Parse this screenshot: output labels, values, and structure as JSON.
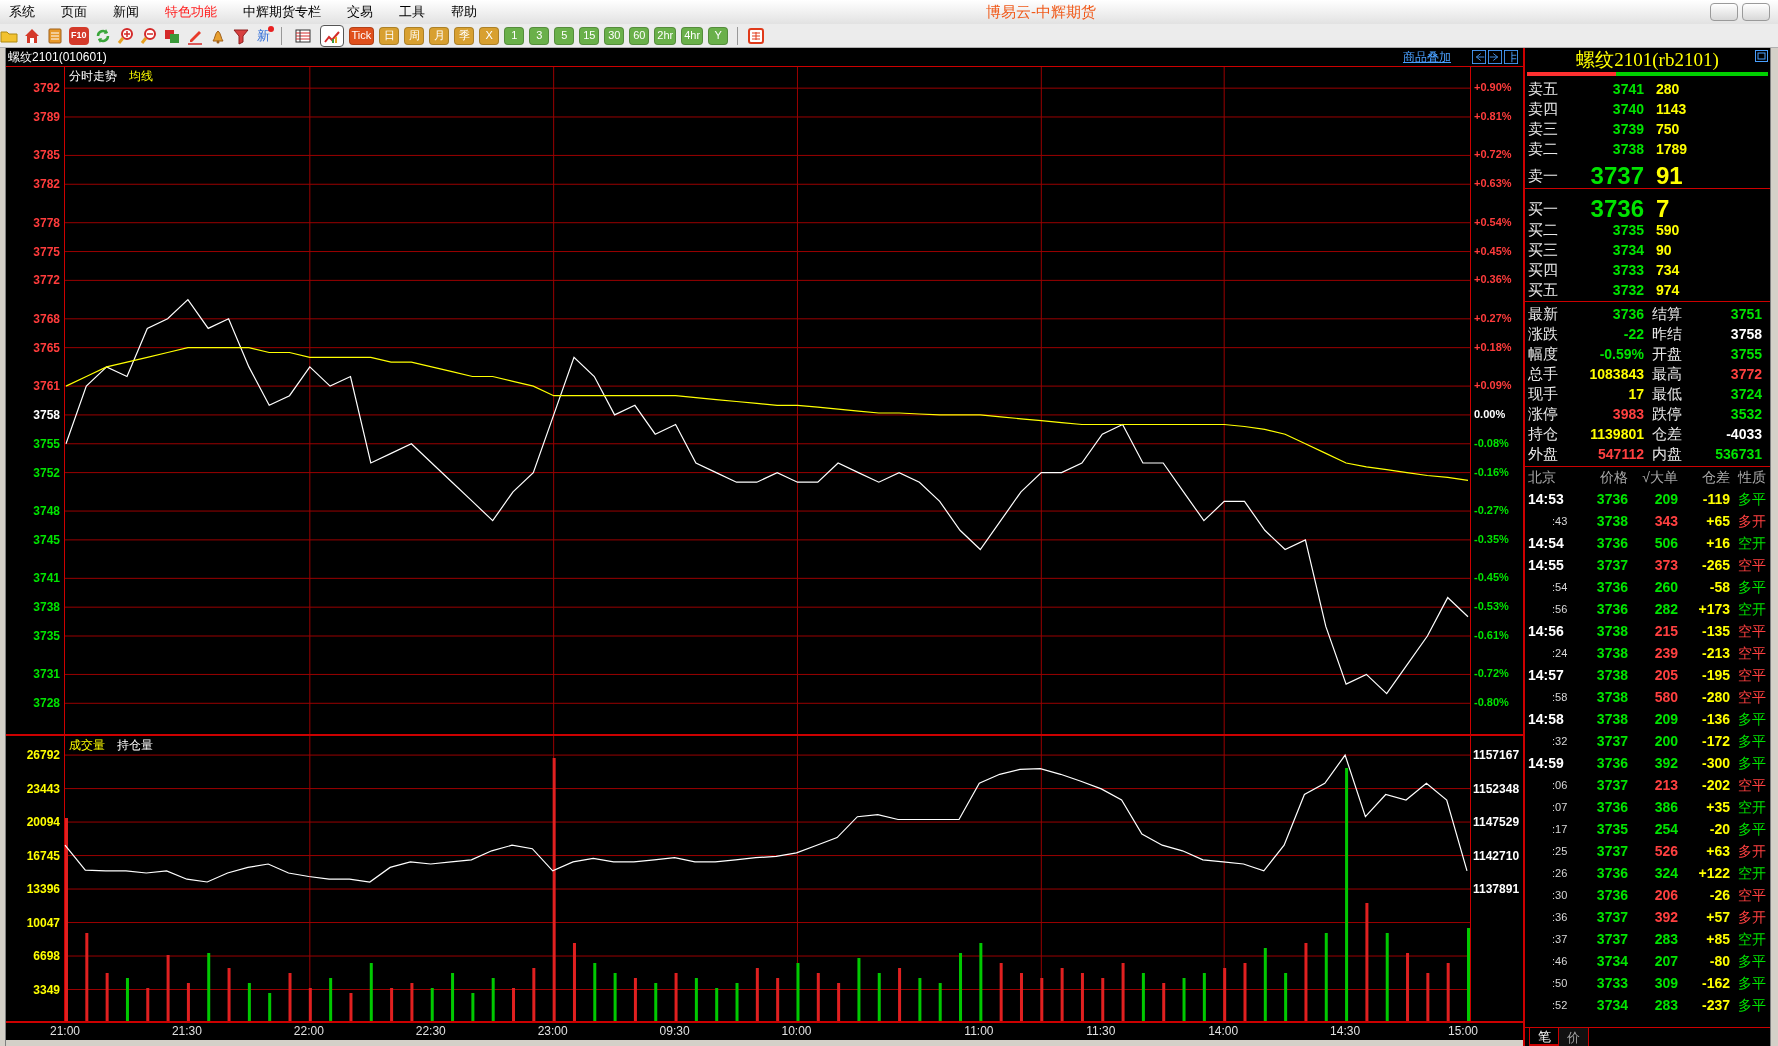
{
  "menu": [
    {
      "label": "系统",
      "highlighted": false
    },
    {
      "label": "页面",
      "highlighted": false
    },
    {
      "label": "新闻",
      "highlighted": false
    },
    {
      "label": "特色功能",
      "highlighted": true
    },
    {
      "label": "中辉期货专栏",
      "highlighted": false
    },
    {
      "label": "交易",
      "highlighted": false
    },
    {
      "label": "工具",
      "highlighted": false
    },
    {
      "label": "帮助",
      "highlighted": false
    }
  ],
  "title": "博易云-中辉期货",
  "toolbar": {
    "f10_label": "F10",
    "news_label": "新",
    "view_buttons": [
      {
        "selected": false
      },
      {
        "selected": true
      }
    ],
    "period_buttons": [
      {
        "label": "Tick",
        "kind": "tick"
      },
      {
        "label": "日",
        "kind": "day"
      },
      {
        "label": "周",
        "kind": "day"
      },
      {
        "label": "月",
        "kind": "day"
      },
      {
        "label": "季",
        "kind": "day"
      },
      {
        "label": "X",
        "kind": "day"
      },
      {
        "label": "1",
        "kind": "minute"
      },
      {
        "label": "3",
        "kind": "minute"
      },
      {
        "label": "5",
        "kind": "minute"
      },
      {
        "label": "15",
        "kind": "minute"
      },
      {
        "label": "30",
        "kind": "minute"
      },
      {
        "label": "60",
        "kind": "minute"
      },
      {
        "label": "2hr",
        "kind": "minute"
      },
      {
        "label": "4hr",
        "kind": "minute"
      },
      {
        "label": "Y",
        "kind": "minute"
      }
    ]
  },
  "chart_header": {
    "symbol": "螺纹2101(010601)",
    "overlay_link": "商品叠加"
  },
  "price_panel": {
    "pct_labels": [
      {
        "label": "+0.90%",
        "color": "#ff3c3c"
      },
      {
        "label": "+0.81%",
        "color": "#ff3c3c"
      },
      {
        "label": "+0.72%",
        "color": "#ff3c3c"
      },
      {
        "label": "+0.63%",
        "color": "#ff3c3c"
      },
      {
        "label": "+0.54%",
        "color": "#ff3c3c"
      },
      {
        "label": "+0.45%",
        "color": "#ff3c3c"
      },
      {
        "label": "+0.36%",
        "color": "#ff3c3c"
      },
      {
        "label": "+0.27%",
        "color": "#ff3c3c"
      },
      {
        "label": "+0.18%",
        "color": "#ff3c3c"
      },
      {
        "label": "+0.09%",
        "color": "#ff3c3c"
      },
      {
        "label": "0.00%",
        "color": "#ffffff"
      },
      {
        "label": "-0.08%",
        "color": "#00e400"
      },
      {
        "label": "-0.16%",
        "color": "#00e400"
      },
      {
        "label": "-0.27%",
        "color": "#00e400"
      },
      {
        "label": "-0.35%",
        "color": "#00e400"
      },
      {
        "label": "-0.45%",
        "color": "#00e400"
      },
      {
        "label": "-0.53%",
        "color": "#00e400"
      },
      {
        "label": "-0.61%",
        "color": "#00e400"
      },
      {
        "label": "-0.72%",
        "color": "#00e400"
      },
      {
        "label": "-0.80%",
        "color": "#00e400"
      }
    ],
    "chart_data": {
      "type": "line",
      "grid": true,
      "ylim": [
        3724.7,
        3794.2
      ],
      "yticks": [
        {
          "value": 3792,
          "label": "3792"
        },
        {
          "value": 3789,
          "label": "3789"
        },
        {
          "value": 3785,
          "label": "3785"
        },
        {
          "value": 3782,
          "label": "3782"
        },
        {
          "value": 3778,
          "label": "3778"
        },
        {
          "value": 3775,
          "label": "3775"
        },
        {
          "value": 3772,
          "label": "3772"
        },
        {
          "value": 3768,
          "label": "3768"
        },
        {
          "value": 3765,
          "label": "3765"
        },
        {
          "value": 3761,
          "label": "3761"
        },
        {
          "value": 3758,
          "label": "3758"
        },
        {
          "value": 3755,
          "label": "3755"
        },
        {
          "value": 3752,
          "label": "3752"
        },
        {
          "value": 3748,
          "label": "3748"
        },
        {
          "value": 3745,
          "label": "3745"
        },
        {
          "value": 3741,
          "label": "3741"
        },
        {
          "value": 3738,
          "label": "3738"
        },
        {
          "value": 3735,
          "label": "3735"
        },
        {
          "value": 3731,
          "label": "3731"
        },
        {
          "value": 3728,
          "label": "3728"
        }
      ],
      "series": [
        {
          "name": "分时走势",
          "color": "#ffffff",
          "values": [
            3755,
            3761,
            3763,
            3762,
            3767,
            3768,
            3770,
            3767,
            3768,
            3763,
            3759,
            3760,
            3763,
            3761,
            3762,
            3753,
            3754,
            3755,
            3753,
            3751,
            3749,
            3747,
            3750,
            3752,
            3758,
            3764,
            3762,
            3758,
            3759,
            3756,
            3757,
            3753,
            3752,
            3751,
            3751,
            3752,
            3751,
            3751,
            3753,
            3752,
            3751,
            3752,
            3751,
            3749,
            3746,
            3744,
            3747,
            3750,
            3752,
            3752,
            3753,
            3756,
            3757,
            3753,
            3753,
            3750,
            3747,
            3749,
            3749,
            3746,
            3744,
            3745,
            3736,
            3730,
            3731,
            3729,
            3732,
            3735,
            3739,
            3737
          ]
        },
        {
          "name": "均线",
          "color": "#ffff00",
          "values": [
            3761,
            3762,
            3763,
            3763.5,
            3764,
            3764.5,
            3765,
            3765,
            3765,
            3765,
            3764.5,
            3764.5,
            3764,
            3764,
            3764,
            3764,
            3763.5,
            3763.5,
            3763,
            3762.5,
            3762,
            3762,
            3761.5,
            3761,
            3760,
            3760,
            3760,
            3760,
            3760,
            3760,
            3760,
            3759.8,
            3759.6,
            3759.4,
            3759.2,
            3759,
            3759,
            3758.8,
            3758.6,
            3758.4,
            3758.2,
            3758.2,
            3758.1,
            3758,
            3758,
            3758,
            3757.8,
            3757.6,
            3757.4,
            3757.2,
            3757,
            3757,
            3757,
            3757,
            3757,
            3757,
            3757,
            3757,
            3756.8,
            3756.5,
            3756,
            3755,
            3754,
            3753,
            3752.6,
            3752.3,
            3752,
            3751.7,
            3751.5,
            3751.2
          ]
        }
      ]
    }
  },
  "volume_panel": {
    "volume": {
      "chart_data": {
        "type": "bar",
        "grid": true,
        "ylim": [
          0,
          28700
        ],
        "yticks": [
          {
            "value": 26792,
            "label": "26792"
          },
          {
            "value": 23443,
            "label": "23443"
          },
          {
            "value": 20094,
            "label": "20094"
          },
          {
            "value": 16745,
            "label": "16745"
          },
          {
            "value": 13396,
            "label": "13396"
          },
          {
            "value": 10047,
            "label": "10047"
          },
          {
            "value": 6698,
            "label": "6698"
          },
          {
            "value": 3349,
            "label": "3349"
          }
        ],
        "categories": [
          "21:00",
          null,
          null,
          null,
          null,
          null,
          "21:30",
          null,
          null,
          null,
          null,
          null,
          "22:00",
          null,
          null,
          null,
          null,
          null,
          "22:30",
          null,
          null,
          null,
          null,
          null,
          "23:00",
          null,
          null,
          null,
          null,
          null,
          "09:30",
          null,
          null,
          null,
          null,
          null,
          "10:00",
          null,
          null,
          null,
          null,
          null,
          null,
          null,
          null,
          "11:00",
          null,
          null,
          null,
          null,
          null,
          "11:30",
          null,
          null,
          null,
          null,
          null,
          "14:00",
          null,
          null,
          null,
          null,
          null,
          "14:30",
          null,
          null,
          null,
          null,
          null,
          "15:00"
        ],
        "series": [
          {
            "name": "成交量",
            "values": [
              20500,
              9000,
              5000,
              4500,
              3500,
              6800,
              4000,
              7000,
              5500,
              4000,
              3000,
              5000,
              3500,
              4500,
              3000,
              6000,
              3500,
              4000,
              3500,
              5000,
              3000,
              4500,
              3500,
              5500,
              26500,
              8000,
              6000,
              5000,
              4500,
              4000,
              5000,
              4500,
              3500,
              4000,
              5500,
              4500,
              6000,
              5000,
              4000,
              6500,
              5000,
              5500,
              4500,
              4000,
              7000,
              8000,
              6000,
              5000,
              4500,
              5500,
              5000,
              4500,
              6000,
              5000,
              4000,
              4500,
              5000,
              5500,
              6000,
              7500,
              5000,
              8000,
              9000,
              25500,
              12000,
              9000,
              7000,
              5000,
              6000,
              9500
            ]
          }
        ]
      }
    },
    "open_interest": {
      "chart_data": {
        "type": "line",
        "ylim": [
          1137891,
          1157167
        ],
        "yticks": [
          {
            "value": 1157167,
            "label": "1157167"
          },
          {
            "value": 1152348,
            "label": "1152348"
          },
          {
            "value": 1147529,
            "label": "1147529"
          },
          {
            "value": 1142710,
            "label": "1142710"
          },
          {
            "value": 1137891,
            "label": "1137891"
          }
        ],
        "series": [
          {
            "name": "持仓量",
            "color": "#ffffff",
            "values": [
              1144200,
              1140600,
              1140500,
              1140500,
              1140200,
              1140500,
              1139300,
              1138900,
              1140200,
              1141000,
              1141500,
              1140200,
              1139700,
              1139300,
              1139300,
              1138900,
              1141000,
              1141800,
              1141500,
              1141800,
              1142100,
              1143400,
              1144200,
              1143700,
              1140500,
              1141800,
              1142300,
              1141800,
              1141800,
              1142100,
              1142400,
              1141800,
              1141800,
              1142100,
              1142400,
              1142600,
              1143100,
              1144200,
              1145300,
              1148300,
              1148600,
              1147900,
              1147900,
              1147900,
              1147900,
              1153100,
              1154400,
              1155100,
              1155200,
              1154400,
              1153400,
              1152300,
              1150700,
              1145800,
              1144200,
              1143400,
              1142100,
              1141800,
              1141500,
              1140500,
              1144200,
              1151500,
              1153100,
              1157167,
              1148300,
              1151500,
              1150700,
              1153100,
              1150700,
              1140500
            ]
          }
        ]
      }
    }
  },
  "quote": {
    "title": "螺纹2101(rb2101)",
    "ratio_bar": {
      "level": 0.37
    },
    "asks": [
      {
        "label": "卖五",
        "price": "3741",
        "volume": "280",
        "best": false
      },
      {
        "label": "卖四",
        "price": "3740",
        "volume": "1143",
        "best": false
      },
      {
        "label": "卖三",
        "price": "3739",
        "volume": "750",
        "best": false
      },
      {
        "label": "卖二",
        "price": "3738",
        "volume": "1789",
        "best": false
      },
      {
        "label": "卖一",
        "price": "3737",
        "volume": "91",
        "best": true
      }
    ],
    "bids": [
      {
        "label": "买一",
        "price": "3736",
        "volume": "7",
        "best": true
      },
      {
        "label": "买二",
        "price": "3735",
        "volume": "590",
        "best": false
      },
      {
        "label": "买三",
        "price": "3734",
        "volume": "90",
        "best": false
      },
      {
        "label": "买四",
        "price": "3733",
        "volume": "734",
        "best": false
      },
      {
        "label": "买五",
        "price": "3732",
        "volume": "974",
        "best": false
      }
    ],
    "fields": [
      {
        "label": "最新",
        "value": "3736",
        "color": "#00e400"
      },
      {
        "label": "结算",
        "value": "3751",
        "color": "#00e400"
      },
      {
        "label": "涨跌",
        "value": "-22",
        "color": "#00e400"
      },
      {
        "label": "昨结",
        "value": "3758",
        "color": "#ffffff"
      },
      {
        "label": "幅度",
        "value": "-0.59%",
        "color": "#00e400"
      },
      {
        "label": "开盘",
        "value": "3755",
        "color": "#00e400"
      },
      {
        "label": "总手",
        "value": "1083843",
        "color": "#ffff00"
      },
      {
        "label": "最高",
        "value": "3772",
        "color": "#ff4040"
      },
      {
        "label": "现手",
        "value": "17",
        "color": "#ffff00"
      },
      {
        "label": "最低",
        "value": "3724",
        "color": "#00e400"
      },
      {
        "label": "涨停",
        "value": "3983",
        "color": "#ff4040"
      },
      {
        "label": "跌停",
        "value": "3532",
        "color": "#00e400"
      },
      {
        "label": "持仓",
        "value": "1139801",
        "color": "#ffff00"
      },
      {
        "label": "仓差",
        "value": "-4033",
        "color": "#ffffff"
      },
      {
        "label": "外盘",
        "value": "547112",
        "color": "#ff4040"
      },
      {
        "label": "内盘",
        "value": "536731",
        "color": "#00e400"
      }
    ]
  },
  "ticks": {
    "columns": [
      "北京",
      "价格",
      "√大单",
      "仓差",
      "性质"
    ],
    "rows": [
      {
        "time": "14:53",
        "kind": "minute",
        "price": "3736",
        "volume": "209",
        "oi_change": "-119",
        "nature": "多平",
        "color": "#00e400"
      },
      {
        "time": ":43",
        "kind": "second",
        "price": "3738",
        "volume": "343",
        "oi_change": "+65",
        "nature": "多开",
        "color": "#ff4040"
      },
      {
        "time": "14:54",
        "kind": "minute",
        "price": "3736",
        "volume": "506",
        "oi_change": "+16",
        "nature": "空开",
        "color": "#00e400"
      },
      {
        "time": "14:55",
        "kind": "minute",
        "price": "3737",
        "volume": "373",
        "oi_change": "-265",
        "nature": "空平",
        "color": "#ff4040"
      },
      {
        "time": ":54",
        "kind": "second",
        "price": "3736",
        "volume": "260",
        "oi_change": "-58",
        "nature": "多平",
        "color": "#00e400"
      },
      {
        "time": ":56",
        "kind": "second",
        "price": "3736",
        "volume": "282",
        "oi_change": "+173",
        "nature": "空开",
        "color": "#00e400"
      },
      {
        "time": "14:56",
        "kind": "minute",
        "price": "3738",
        "volume": "215",
        "oi_change": "-135",
        "nature": "空平",
        "color": "#ff4040"
      },
      {
        "time": ":24",
        "kind": "second",
        "price": "3738",
        "volume": "239",
        "oi_change": "-213",
        "nature": "空平",
        "color": "#ff4040"
      },
      {
        "time": "14:57",
        "kind": "minute",
        "price": "3738",
        "volume": "205",
        "oi_change": "-195",
        "nature": "空平",
        "color": "#ff4040"
      },
      {
        "time": ":58",
        "kind": "second",
        "price": "3738",
        "volume": "580",
        "oi_change": "-280",
        "nature": "空平",
        "color": "#ff4040"
      },
      {
        "time": "14:58",
        "kind": "minute",
        "price": "3738",
        "volume": "209",
        "oi_change": "-136",
        "nature": "多平",
        "color": "#00e400"
      },
      {
        "time": ":32",
        "kind": "second",
        "price": "3737",
        "volume": "200",
        "oi_change": "-172",
        "nature": "多平",
        "color": "#00e400"
      },
      {
        "time": "14:59",
        "kind": "minute",
        "price": "3736",
        "volume": "392",
        "oi_change": "-300",
        "nature": "多平",
        "color": "#00e400"
      },
      {
        "time": ":06",
        "kind": "second",
        "price": "3737",
        "volume": "213",
        "oi_change": "-202",
        "nature": "空平",
        "color": "#ff4040"
      },
      {
        "time": ":07",
        "kind": "second",
        "price": "3736",
        "volume": "386",
        "oi_change": "+35",
        "nature": "空开",
        "color": "#00e400"
      },
      {
        "time": ":17",
        "kind": "second",
        "price": "3735",
        "volume": "254",
        "oi_change": "-20",
        "nature": "多平",
        "color": "#00e400"
      },
      {
        "time": ":25",
        "kind": "second",
        "price": "3737",
        "volume": "526",
        "oi_change": "+63",
        "nature": "多开",
        "color": "#ff4040"
      },
      {
        "time": ":26",
        "kind": "second",
        "price": "3736",
        "volume": "324",
        "oi_change": "+122",
        "nature": "空开",
        "color": "#00e400"
      },
      {
        "time": ":30",
        "kind": "second",
        "price": "3736",
        "volume": "206",
        "oi_change": "-26",
        "nature": "空平",
        "color": "#ff4040"
      },
      {
        "time": ":36",
        "kind": "second",
        "price": "3737",
        "volume": "392",
        "oi_change": "+57",
        "nature": "多开",
        "color": "#ff4040"
      },
      {
        "time": ":37",
        "kind": "second",
        "price": "3737",
        "volume": "283",
        "oi_change": "+85",
        "nature": "空开",
        "color": "#00e400"
      },
      {
        "time": ":46",
        "kind": "second",
        "price": "3734",
        "volume": "207",
        "oi_change": "-80",
        "nature": "多平",
        "color": "#00e400"
      },
      {
        "time": ":50",
        "kind": "second",
        "price": "3733",
        "volume": "309",
        "oi_change": "-162",
        "nature": "多平",
        "color": "#00e400"
      },
      {
        "time": ":52",
        "kind": "second",
        "price": "3734",
        "volume": "283",
        "oi_change": "-237",
        "nature": "多平",
        "color": "#00e400"
      }
    ]
  },
  "bottom_tabs": [
    {
      "label": "笔",
      "selected": true
    },
    {
      "label": "价",
      "selected": false
    }
  ]
}
